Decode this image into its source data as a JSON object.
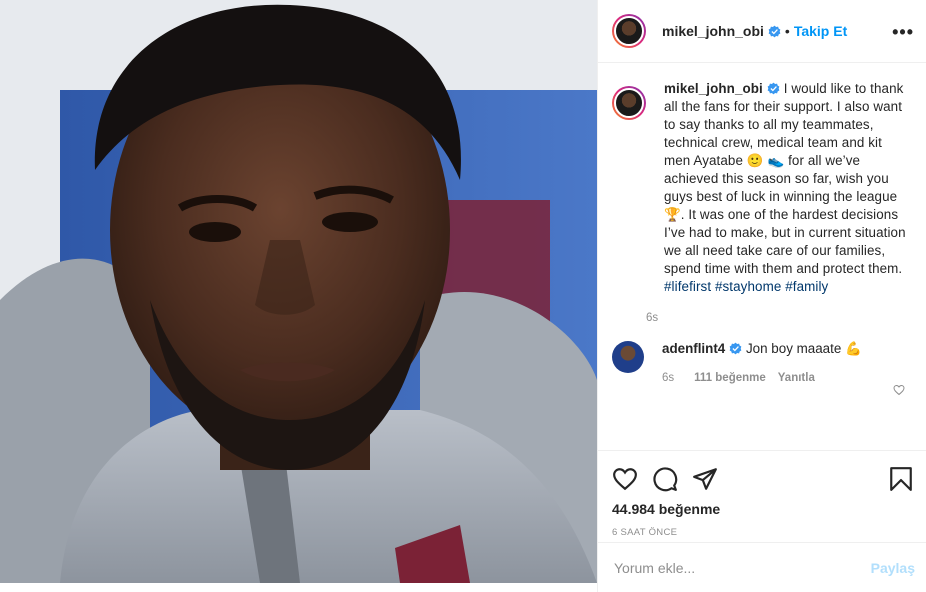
{
  "post": {
    "username": "mikel_john_obi",
    "follow_label": "Takip Et",
    "more_label": "•••",
    "separator": "•",
    "caption_parts": {
      "p1": "I would like to thank all the fans for their support. I also want to say thanks to all my teammates, technical crew, medical team and kit men Ayatabe ",
      "emoji1": "🙂",
      "emoji2": "👟",
      "p2": " for all we’ve achieved this season so far, wish you guys best of luck in winning the league",
      "emoji3": "🏆",
      "p3": ". It was one of the hardest decisions I’ve had to make, but in current situation we all need take care of our families, spend time with them and protect them. ",
      "tag1": "#lifefirst",
      "tag2": "#stayhome",
      "tag3": "#family"
    },
    "caption_time": "6s"
  },
  "comment": {
    "username": "adenflint4",
    "text": "Jon boy maaate",
    "emoji": "💪",
    "time": "6s",
    "likes": "111 beğenme",
    "reply": "Yanıtla"
  },
  "actions": {
    "likes_count": "44.984 beğenme",
    "posted_ago": "6 SAAT ÖNCE"
  },
  "add_comment": {
    "placeholder": "Yorum ekle...",
    "share_label": "Paylaş"
  },
  "colors": {
    "accent_blue": "#0095f6",
    "share_disabled": "#b2dffc",
    "hashtag": "#00376b",
    "secondary_text": "#8e8e8e",
    "border": "#efefef"
  },
  "icons": [
    "verified-badge-icon",
    "heart-icon",
    "comment-icon",
    "share-icon",
    "bookmark-icon",
    "more-options-icon"
  ]
}
